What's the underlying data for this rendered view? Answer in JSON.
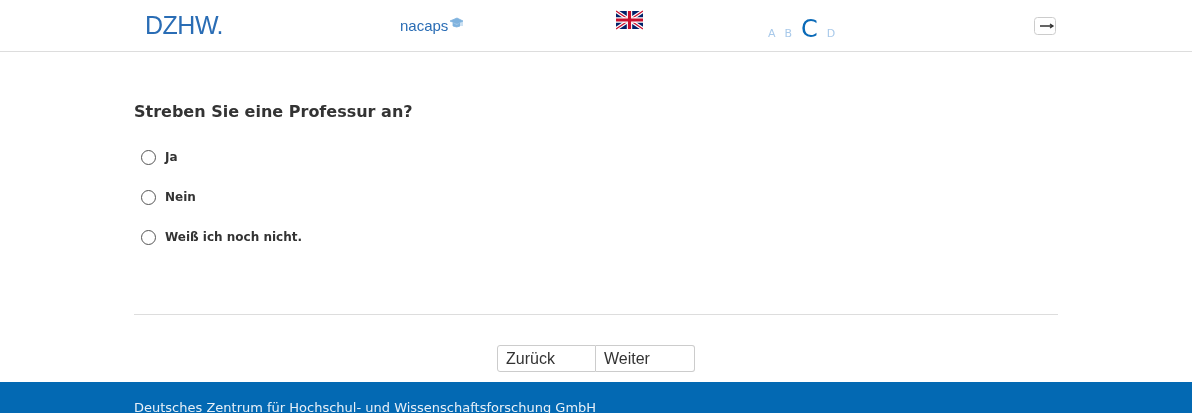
{
  "header": {
    "logo": "DZHW.",
    "brand": "nacaps",
    "font_sizes": [
      {
        "label": "A",
        "selected": false
      },
      {
        "label": "B",
        "selected": false
      },
      {
        "label": "C",
        "selected": true
      },
      {
        "label": "D",
        "selected": false
      }
    ]
  },
  "question": {
    "title": "Streben Sie eine Professur an?",
    "options": [
      {
        "label": "Ja",
        "selected": false
      },
      {
        "label": "Nein",
        "selected": false
      },
      {
        "label": "Weiß ich noch nicht.",
        "selected": false
      }
    ]
  },
  "buttons": [
    "Zurück",
    "Weiter"
  ],
  "footer": "Deutsches Zentrum für Hochschul- und Wissenschaftsforschung GmbH"
}
